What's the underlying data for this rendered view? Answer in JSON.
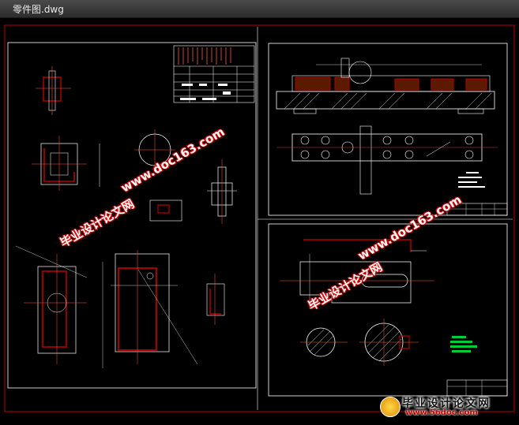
{
  "window": {
    "title": "零件图.dwg"
  },
  "colors": {
    "frame_red": "#b80000",
    "line_white": "#ffffff",
    "accent_green": "#00cc33",
    "background": "#000000"
  },
  "watermarks": {
    "site_name": "毕业设计论文网",
    "site_url": "www.doc163.com"
  },
  "footer": {
    "logo_text": "毕业设计论文网",
    "logo_url": "www.56doc.com",
    "logo_icon": "medal-icon"
  }
}
